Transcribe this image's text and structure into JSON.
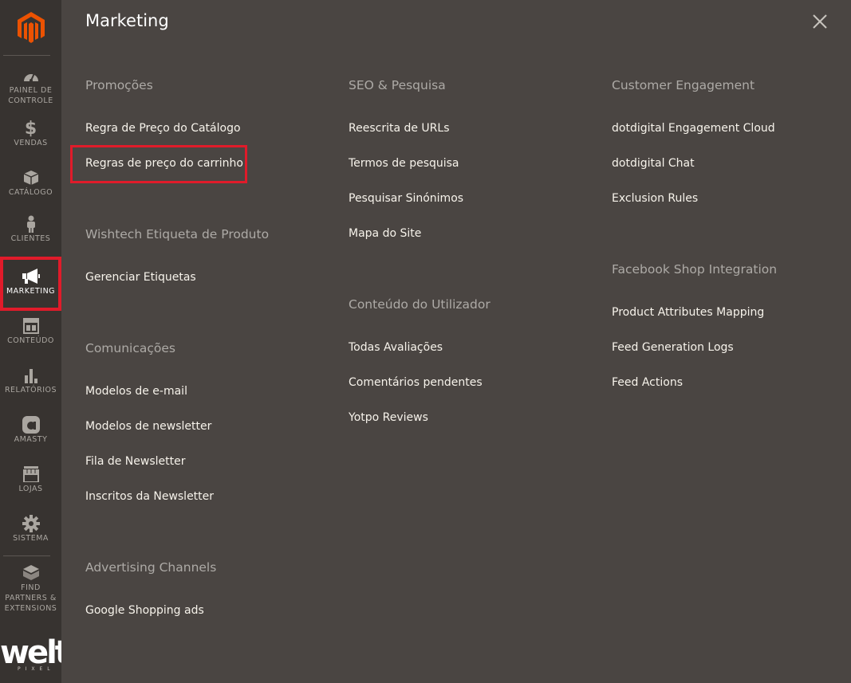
{
  "panel": {
    "title": "Marketing"
  },
  "sidebar": {
    "items": [
      {
        "label": "PAINEL DE CONTROLE",
        "icon": "dashboard-icon"
      },
      {
        "label": "VENDAS",
        "icon": "dollar-icon"
      },
      {
        "label": "CATÁLOGO",
        "icon": "box-icon"
      },
      {
        "label": "CLIENTES",
        "icon": "person-icon"
      },
      {
        "label": "MARKETING",
        "icon": "megaphone-icon"
      },
      {
        "label": "CONTEÚDO",
        "icon": "layout-icon"
      },
      {
        "label": "RELATÓRIOS",
        "icon": "bar-chart-icon"
      },
      {
        "label": "AMASTY",
        "icon": "amasty-icon"
      },
      {
        "label": "LOJAS",
        "icon": "store-icon"
      },
      {
        "label": "SISTEMA",
        "icon": "gear-icon"
      },
      {
        "label": "FIND PARTNERS & EXTENSIONS",
        "icon": "blocks-icon"
      }
    ],
    "brand": {
      "word": "welt",
      "sub": "PIXEL"
    }
  },
  "columns": [
    {
      "sections": [
        {
          "title": "Promoções",
          "links": [
            "Regra de Preço do Catálogo",
            "Regras de preço do carrinho"
          ]
        },
        {
          "title": "Wishtech Etiqueta de Produto",
          "links": [
            "Gerenciar Etiquetas"
          ]
        },
        {
          "title": "Comunicações",
          "links": [
            "Modelos de e-mail",
            "Modelos de newsletter",
            "Fila de Newsletter",
            "Inscritos da Newsletter"
          ]
        },
        {
          "title": "Advertising Channels",
          "links": [
            "Google Shopping ads"
          ]
        }
      ]
    },
    {
      "sections": [
        {
          "title": "SEO & Pesquisa",
          "links": [
            "Reescrita de URLs",
            "Termos de pesquisa",
            "Pesquisar Sinónimos",
            "Mapa do Site"
          ]
        },
        {
          "title": "Conteúdo do Utilizador",
          "links": [
            "Todas Avaliações",
            "Comentários pendentes",
            "Yotpo Reviews"
          ]
        }
      ]
    },
    {
      "sections": [
        {
          "title": "Customer Engagement",
          "links": [
            "dotdigital Engagement Cloud",
            "dotdigital Chat",
            "Exclusion Rules"
          ]
        },
        {
          "title": "Facebook Shop Integration",
          "links": [
            "Product Attributes Mapping",
            "Feed Generation Logs",
            "Feed Actions"
          ]
        }
      ]
    }
  ],
  "colors": {
    "highlight": "#e01b2a",
    "accent": "#eb5202"
  }
}
